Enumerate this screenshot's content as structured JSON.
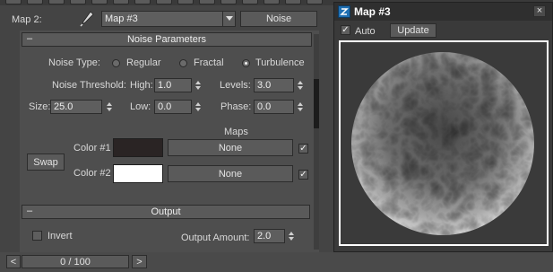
{
  "map_row": {
    "label": "Map 2:",
    "map_name": "Map #3",
    "map_type": "Noise"
  },
  "noise_params": {
    "title": "Noise Parameters",
    "noise_type_label": "Noise Type:",
    "types": [
      "Regular",
      "Fractal",
      "Turbulence"
    ],
    "selected_type": "Turbulence",
    "threshold_label": "Noise Threshold:",
    "high_label": "High:",
    "high_value": "1.0",
    "levels_label": "Levels:",
    "levels_value": "3.0",
    "size_label": "Size:",
    "size_value": "25.0",
    "low_label": "Low:",
    "low_value": "0.0",
    "phase_label": "Phase:",
    "phase_value": "0.0",
    "maps_label": "Maps",
    "swap_label": "Swap",
    "color1_label": "Color #1",
    "color1": "#2a2424",
    "color1_map": "None",
    "color2_label": "Color #2",
    "color2": "#ffffff",
    "color2_map": "None"
  },
  "output": {
    "title": "Output",
    "invert_label": "Invert",
    "amount_label": "Output Amount:",
    "amount_value": "2.0"
  },
  "time": {
    "frame": "0 / 100"
  },
  "map_window": {
    "title": "Map #3",
    "auto_label": "Auto",
    "update_label": "Update",
    "close_glyph": "×"
  },
  "colors": {
    "accent": "#1f6fb2",
    "panel": "#444444"
  }
}
